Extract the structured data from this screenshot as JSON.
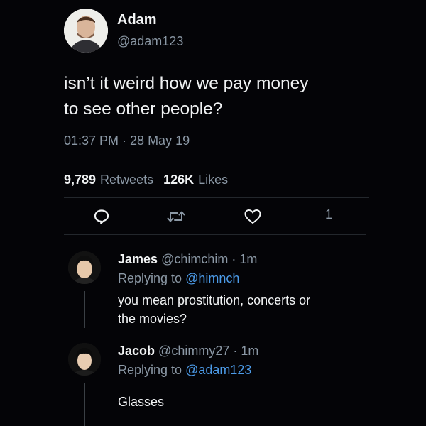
{
  "main_tweet": {
    "author_name": "Adam",
    "author_handle": "@adam123",
    "text_line1": "isn’t it weird how we pay money",
    "text_line2": "to see other people?",
    "timestamp": "01:37 PM · 28 May 19",
    "retweets_count": "9,789",
    "retweets_label": "Retweets",
    "likes_count": "126K",
    "likes_label": "Likes",
    "like_action_count": "1"
  },
  "replies": [
    {
      "name": "James",
      "handle": "@chimchim",
      "time": "· 1m",
      "replying_prefix": "Replying to",
      "replying_to": "@himnch",
      "text_line1": "you mean prostitution, concerts or",
      "text_line2": "the movies?"
    },
    {
      "name": "Jacob",
      "handle": "@chimmy27",
      "time": "· 1m",
      "replying_prefix": "Replying to",
      "replying_to": "@adam123",
      "text_line1": "Glasses"
    }
  ],
  "icons": {
    "reply": "reply-icon",
    "retweet": "retweet-icon",
    "like": "heart-icon"
  },
  "colors": {
    "background": "#040407",
    "text": "#f1f3f4",
    "muted": "#8b98a5",
    "mention": "#4c9be8"
  }
}
